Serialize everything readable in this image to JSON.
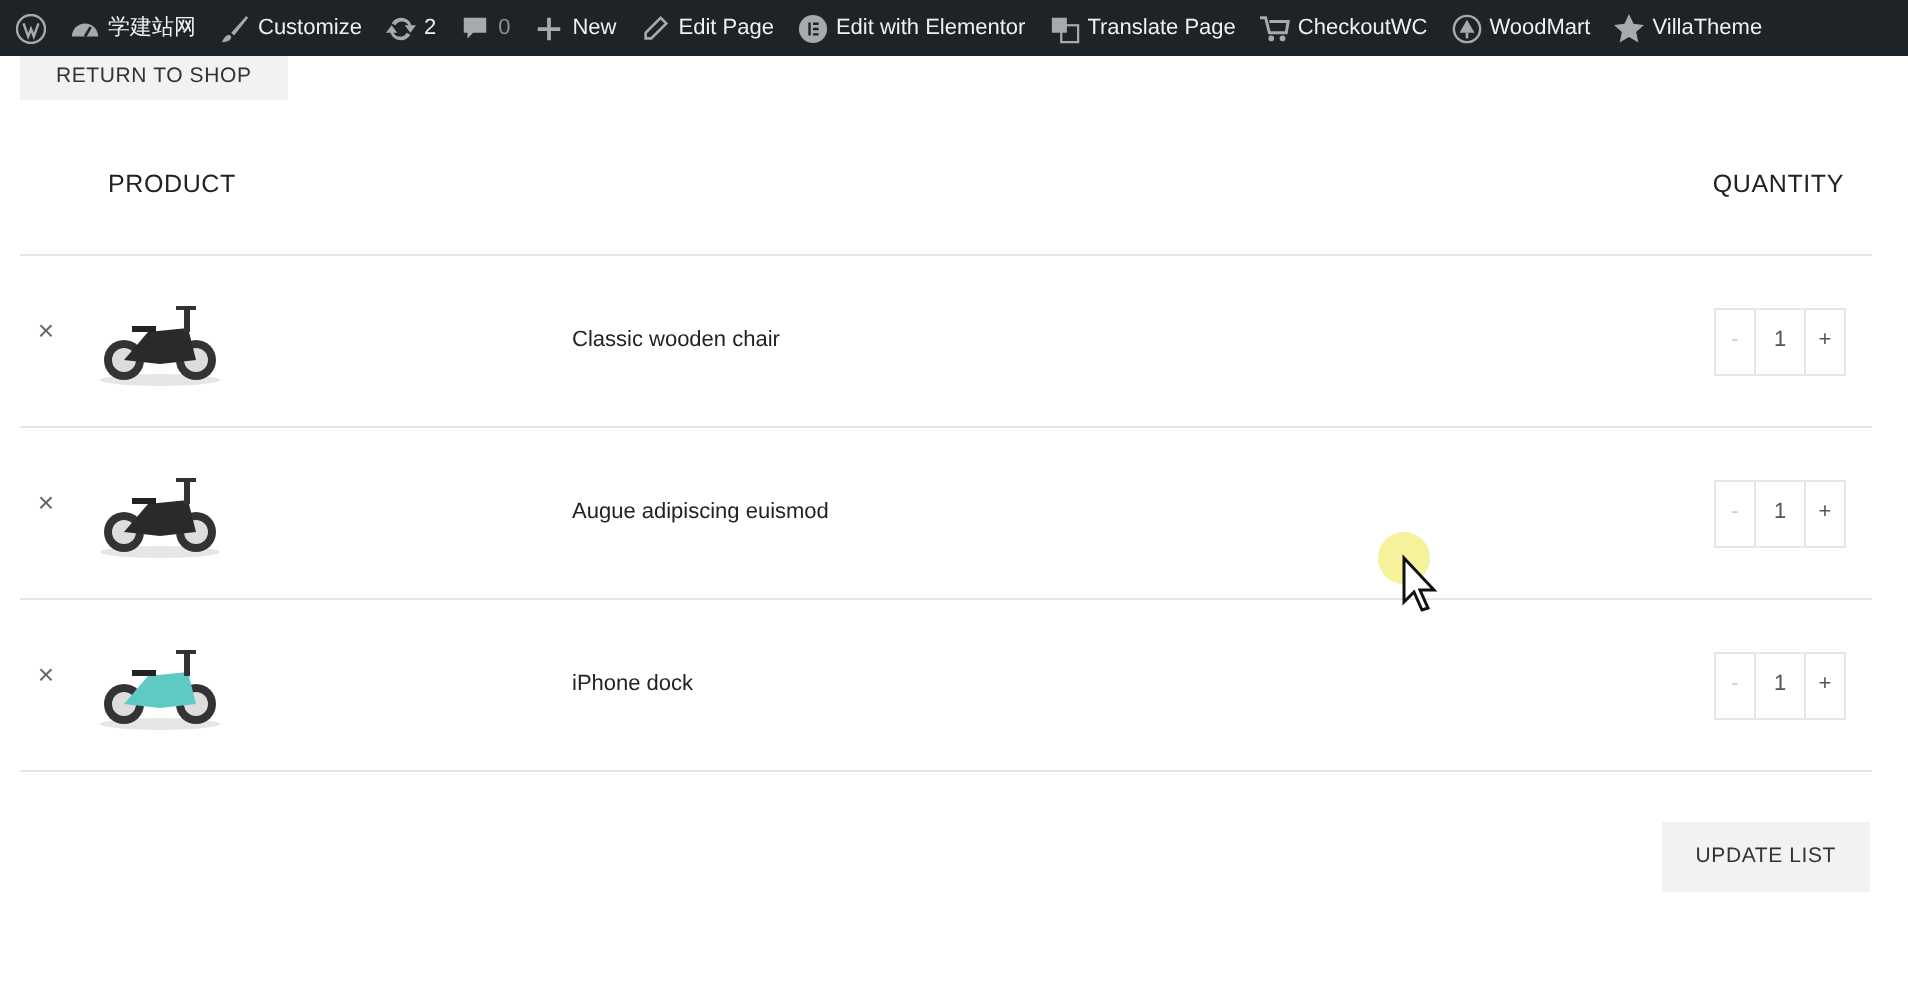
{
  "admin_bar": [
    {
      "kind": "wp"
    },
    {
      "kind": "dashboard",
      "label": "学建站网"
    },
    {
      "kind": "brush",
      "label": "Customize"
    },
    {
      "kind": "updates",
      "label": "2"
    },
    {
      "kind": "comments",
      "label": "0"
    },
    {
      "kind": "plus",
      "label": "New"
    },
    {
      "kind": "pencil",
      "label": "Edit Page"
    },
    {
      "kind": "elementor",
      "label": "Edit with Elementor"
    },
    {
      "kind": "translate",
      "label": "Translate Page"
    },
    {
      "kind": "cart",
      "label": "CheckoutWC"
    },
    {
      "kind": "tree",
      "label": "WoodMart"
    },
    {
      "kind": "star",
      "label": "VillaTheme"
    }
  ],
  "return_button": "RETURN TO SHOP",
  "table": {
    "columns": [
      "PRODUCT",
      "QUANTITY"
    ],
    "rows": [
      {
        "remove": "×",
        "name": "Classic wooden chair",
        "quantity": {
          "minus": "-",
          "value": "1",
          "plus": "+",
          "minus_disabled": true
        }
      },
      {
        "remove": "×",
        "name": "Augue adipiscing euismod",
        "quantity": {
          "minus": "-",
          "value": "1",
          "plus": "+",
          "minus_disabled": true
        }
      },
      {
        "remove": "×",
        "name": "iPhone dock",
        "quantity": {
          "minus": "-",
          "value": "1",
          "plus": "+",
          "minus_disabled": true
        }
      }
    ]
  },
  "update_button": "UPDATE LIST"
}
